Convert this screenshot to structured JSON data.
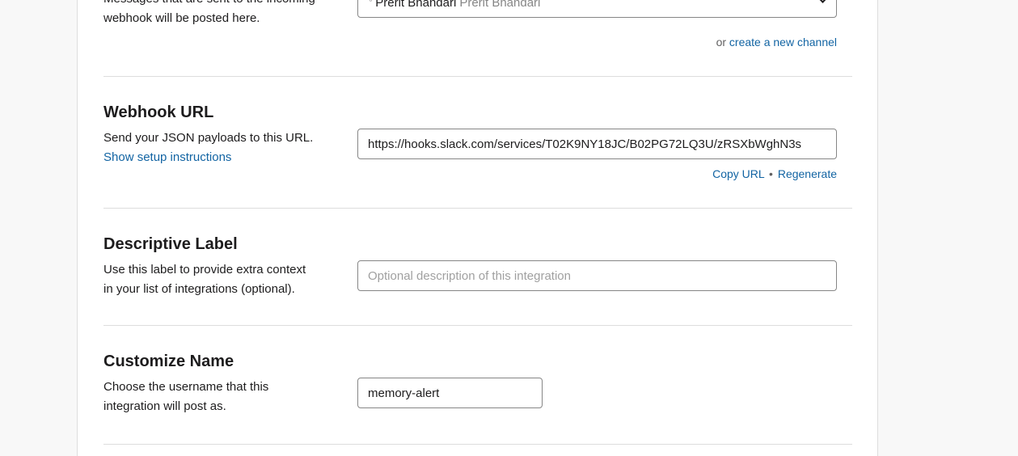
{
  "channel_section": {
    "description_line1": "Messages that are sent to the incoming",
    "description_line2": "webhook will be posted here.",
    "select_primary": "Prerit Bhandari",
    "select_secondary": "Prerit Bhandari",
    "or_text": "or",
    "create_channel_link": "create a new channel"
  },
  "webhook_section": {
    "title": "Webhook URL",
    "description": "Send your JSON payloads to this URL.",
    "setup_link": "Show setup instructions",
    "url_value": "https://hooks.slack.com/services/T02K9NY18JC/B02PG72LQ3U/zRSXbWghN3s",
    "copy_link": "Copy URL",
    "separator": "•",
    "regenerate_link": "Regenerate"
  },
  "label_section": {
    "title": "Descriptive Label",
    "description_line1": "Use this label to provide extra context",
    "description_line2": "in your list of integrations (optional).",
    "placeholder": "Optional description of this integration"
  },
  "name_section": {
    "title": "Customize Name",
    "description_line1": "Choose the username that this",
    "description_line2": "integration will post as.",
    "value": "memory-alert"
  }
}
